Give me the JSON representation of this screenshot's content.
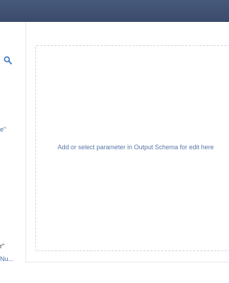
{
  "left_panel": {
    "search_icon": "search-icon",
    "visible_fragments": [
      "e\"",
      "r\"",
      "Nu..."
    ]
  },
  "editor": {
    "empty_hint": "Add or select parameter in Output Schema for edit here"
  },
  "colors": {
    "topbar": "#3f5070",
    "accent_blue": "#4a6fa5",
    "hint_text": "#5a77a8",
    "border": "#d2d6dc"
  }
}
